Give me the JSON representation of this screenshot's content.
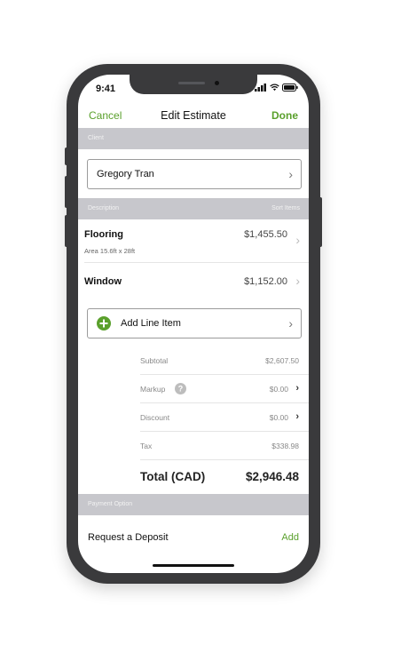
{
  "status": {
    "time": "9:41"
  },
  "nav": {
    "cancel": "Cancel",
    "title": "Edit Estimate",
    "done": "Done"
  },
  "client": {
    "section_label": "Client",
    "name": "Gregory Tran"
  },
  "description": {
    "section_label": "Description",
    "sort_label": "Sort Items",
    "items": [
      {
        "title": "Flooring",
        "subtitle": "Area 15.6ft x 28ft",
        "amount": "$1,455.50"
      },
      {
        "title": "Window",
        "amount": "$1,152.00"
      }
    ],
    "add_line_label": "Add Line Item"
  },
  "summary": {
    "subtotal_label": "Subtotal",
    "subtotal_value": "$2,607.50",
    "markup_label": "Markup",
    "markup_value": "$0.00",
    "discount_label": "Discount",
    "discount_value": "$0.00",
    "tax_label": "Tax",
    "tax_value": "$338.98",
    "total_label": "Total (CAD)",
    "total_value": "$2,946.48"
  },
  "payment": {
    "section_label": "Payment Option",
    "deposit_label": "Request a Deposit",
    "add_label": "Add"
  },
  "colors": {
    "accent": "#5aa02c",
    "section_bg": "#c7c7cc",
    "frame": "#3a3a3c"
  }
}
